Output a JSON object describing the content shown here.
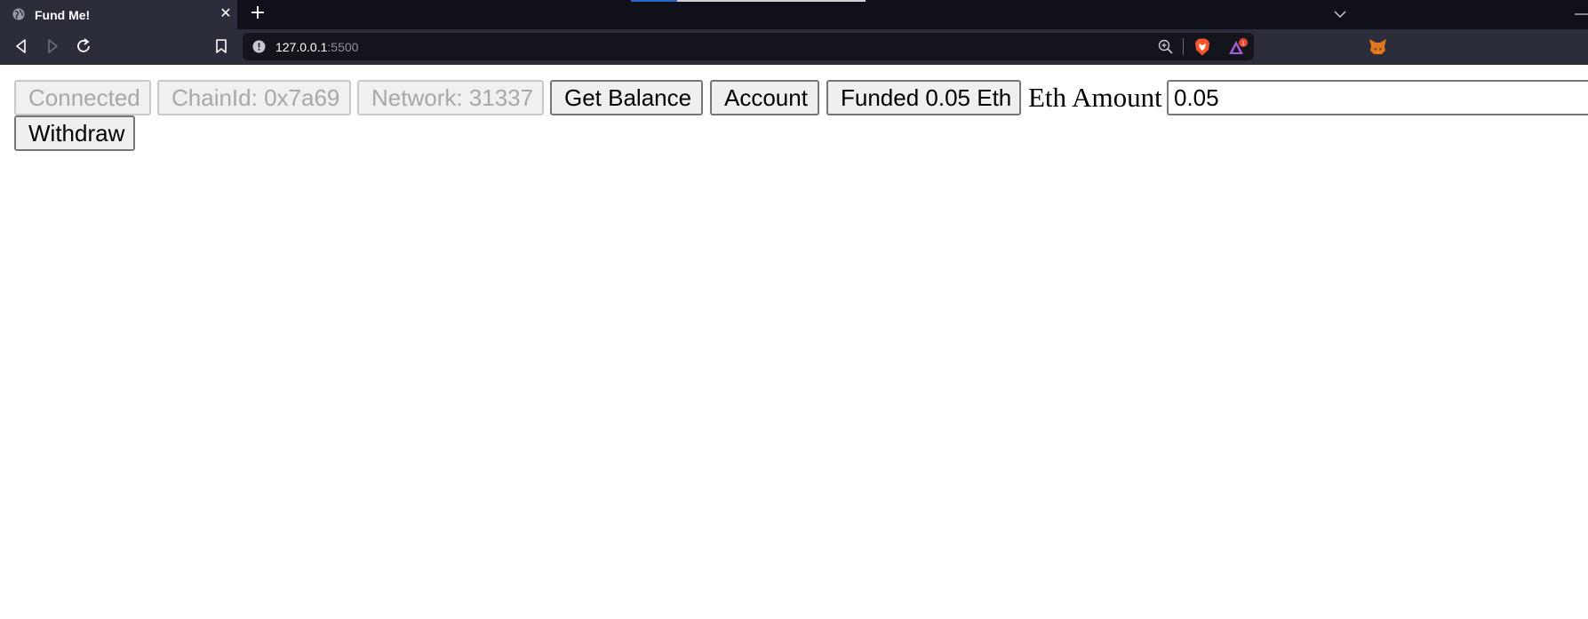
{
  "browser": {
    "tab": {
      "title": "Fund Me!",
      "close_label": "✕"
    },
    "new_tab_label": "+",
    "address": {
      "host": "127.0.0.1",
      "port": ":5500"
    },
    "rewards_badge": "1"
  },
  "page": {
    "connect_button": "Connected",
    "chain_button": "ChainId: 0x7a69",
    "network_button": "Network: 31337",
    "balance_button": "Get Balance",
    "account_button": "Account",
    "fund_button": "Funded 0.05 Eth",
    "eth_amount_label": "Eth Amount",
    "eth_amount_value": "0.05",
    "withdraw_button": "Withdraw"
  }
}
